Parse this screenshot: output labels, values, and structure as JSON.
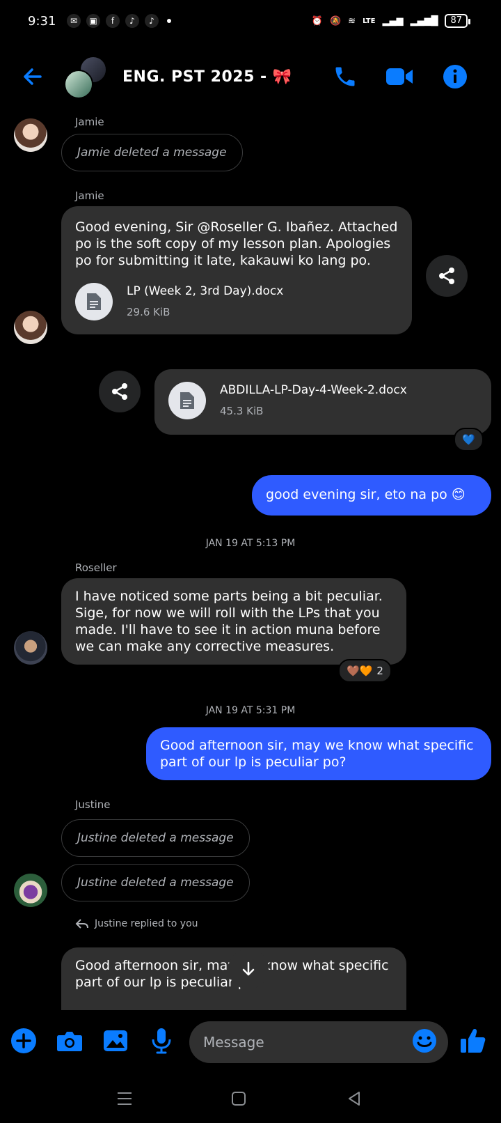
{
  "status_bar": {
    "time": "9:31",
    "battery": "87",
    "network": "LTE"
  },
  "header": {
    "title": "ENG. PST 2025 - 🎀",
    "accent_color": "#0a7cff"
  },
  "messages": {
    "m1": {
      "sender": "Jamie",
      "deleted_text": "Jamie deleted a message"
    },
    "m2": {
      "sender": "Jamie",
      "text": "Good evening, Sir @Roseller G. Ibañez. Attached po is the soft copy of my lesson plan. Apologies po for submitting it late, kakauwi ko lang po.",
      "file_name": "LP (Week 2, 3rd Day).docx",
      "file_size": "29.6 KiB"
    },
    "m3": {
      "file_name": "ABDILLA-LP-Day-4-Week-2.docx",
      "file_size": "45.3 KiB",
      "reaction": "💙"
    },
    "m4": {
      "text": "good evening sir, eto na po 😊"
    },
    "sep1": "JAN 19 AT 5:13 PM",
    "m5": {
      "sender": "Roseller",
      "text": "I have noticed some parts being a bit peculiar. Sige, for now we will roll with the LPs that you made. I'll have to see it in action muna before we can make any corrective measures.",
      "reactions": "🤎🧡",
      "reaction_count": "2"
    },
    "sep2": "JAN 19 AT 5:31 PM",
    "m6": {
      "text": "Good afternoon sir, may we know what specific part of our lp is peculiar po?"
    },
    "m7": {
      "sender": "Justine",
      "deleted_text_1": "Justine deleted a message",
      "deleted_text_2": "Justine deleted a message"
    },
    "m8": {
      "reply_label": "Justine replied to you",
      "text": "Good afternoon sir, may we know what specific part of our lp is peculiar po?"
    }
  },
  "composer": {
    "placeholder": "Message"
  },
  "colors": {
    "outgoing_bubble": "#2f5bff",
    "incoming_bubble": "#303030",
    "background": "#000000"
  }
}
